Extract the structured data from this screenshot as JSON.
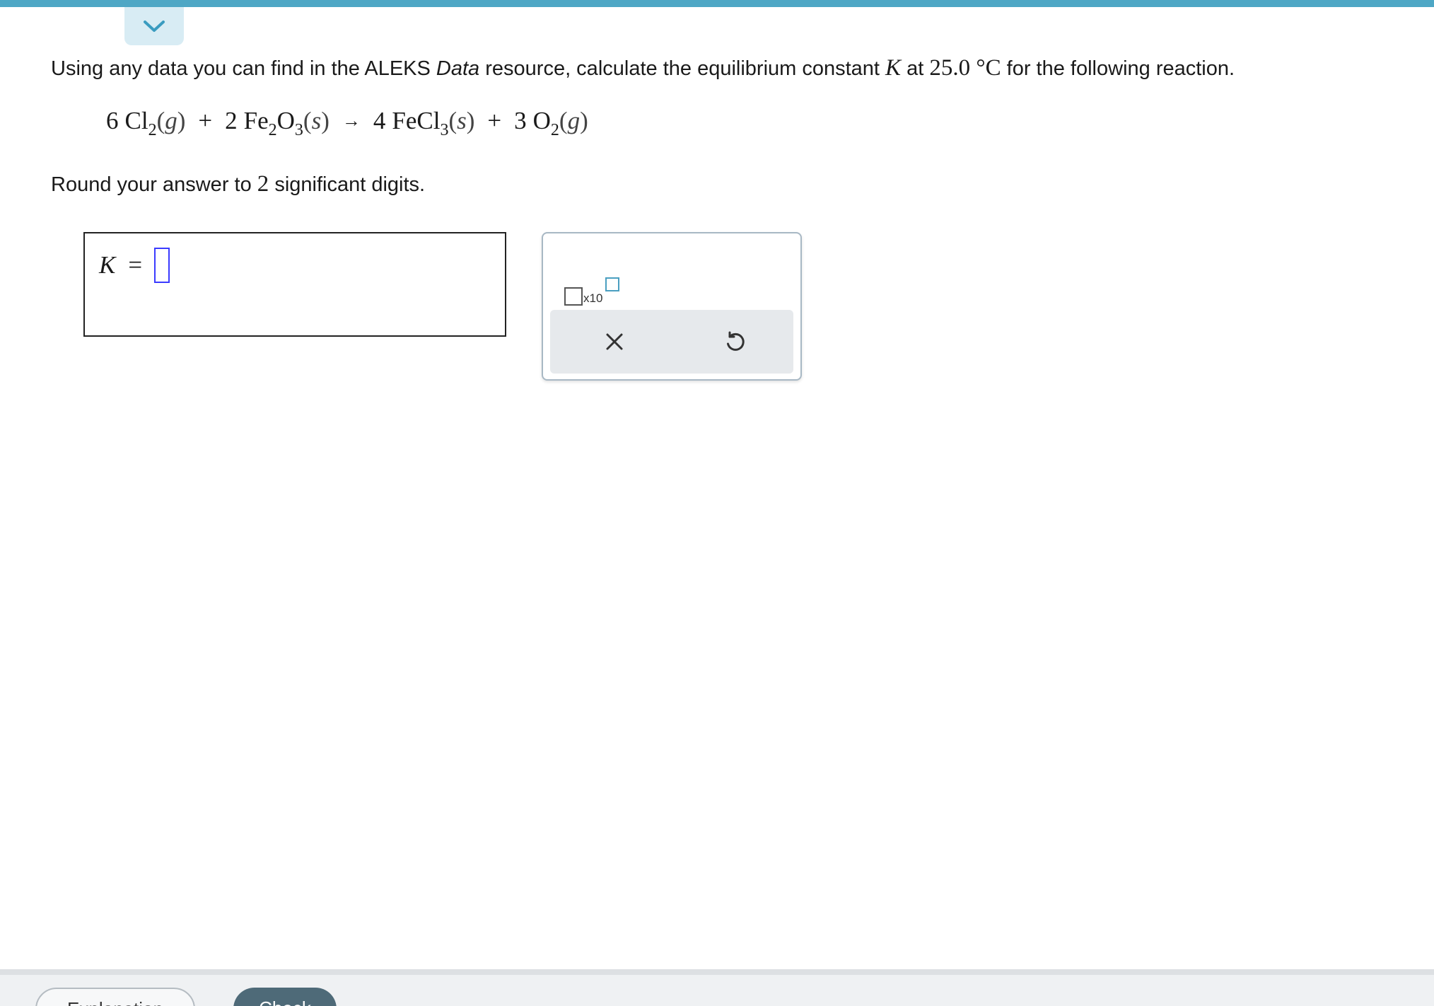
{
  "question": {
    "prompt_pre": "Using any data you can find in the ALEKS ",
    "prompt_data_word": "Data",
    "prompt_mid": " resource, calculate the equilibrium constant ",
    "prompt_K": "K",
    "prompt_at": " at ",
    "prompt_temp": "25.0 °C",
    "prompt_post": " for the following reaction.",
    "round_pre": "Round your answer to ",
    "round_num": "2",
    "round_post": " significant digits."
  },
  "equation": {
    "r1_coef": "6",
    "r1_elem": "Cl",
    "r1_sub": "2",
    "r1_state": "g",
    "plus": "+",
    "r2_coef": "2",
    "r2_elem1": "Fe",
    "r2_sub1": "2",
    "r2_elem2": "O",
    "r2_sub2": "3",
    "r2_state": "s",
    "arrow": "→",
    "p1_coef": "4",
    "p1_elem": "FeCl",
    "p1_sub": "3",
    "p1_state": "s",
    "p2_coef": "3",
    "p2_elem": "O",
    "p2_sub": "2",
    "p2_state": "g"
  },
  "answer": {
    "variable": "K",
    "equals": "=",
    "value": ""
  },
  "tools": {
    "x10_label": "x10",
    "clear_icon": "close-icon",
    "undo_icon": "undo-icon"
  },
  "footer": {
    "explanation_label": "Explanation",
    "check_label": "Check"
  },
  "colors": {
    "top_bar": "#4ea7c5",
    "tab_bg": "#d8ecf4",
    "input_border": "#3b3bff",
    "check_bg": "#4e6a78"
  }
}
